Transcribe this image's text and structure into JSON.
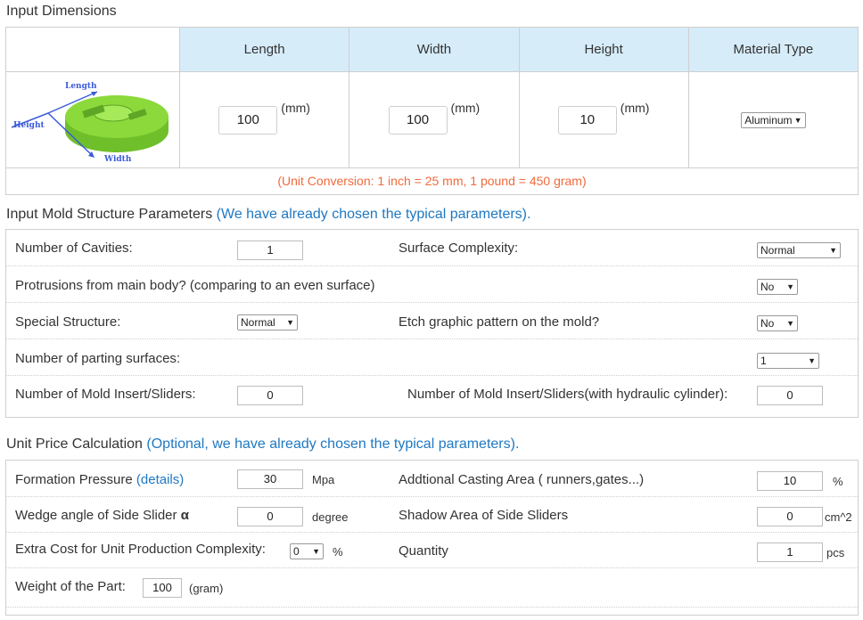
{
  "dimensions": {
    "title": "Input Dimensions",
    "headers": [
      "Length",
      "Width",
      "Height",
      "Material Type"
    ],
    "length": "100",
    "width": "100",
    "height": "10",
    "unit": "(mm)",
    "material": "Aluminum",
    "image_labels": {
      "length": "Length",
      "height": "Height",
      "width": "Width"
    },
    "unit_conversion": "(Unit Conversion: 1 inch = 25 mm, 1 pound = 450 gram)"
  },
  "mold": {
    "title": "Input Mold Structure Parameters",
    "note": "(We have already chosen the typical parameters).",
    "cavities_label": "Number of Cavities:",
    "cavities": "1",
    "surface_label": "Surface Complexity:",
    "surface": "Normal",
    "protrusions_label": "Protrusions from main body? (comparing to an even surface)",
    "protrusions": "No",
    "special_label": "Special Structure:",
    "special": "Normal",
    "etch_label": "Etch graphic pattern on the mold?",
    "etch": "No",
    "parting_label": "Number of parting surfaces:",
    "parting": "1",
    "insert_label": "Number of Mold Insert/Sliders:",
    "insert": "0",
    "insert_hyd_label": "Number of Mold Insert/Sliders(with hydraulic cylinder):",
    "insert_hyd": "0"
  },
  "unit_price": {
    "title": "Unit Price Calculation",
    "note": "(Optional, we have already chosen the typical parameters).",
    "pressure_label": "Formation Pressure",
    "pressure_link": "(details)",
    "pressure": "30",
    "pressure_unit": "Mpa",
    "casting_label": "Addtional Casting Area ( runners,gates...)",
    "casting": "10",
    "casting_unit": "%",
    "wedge_label": "Wedge angle of Side Slider",
    "wedge_symbol": "α",
    "wedge": "0",
    "wedge_unit": "degree",
    "shadow_label": "Shadow Area of Side Sliders",
    "shadow": "0",
    "shadow_unit": "cm^2",
    "extra_label": "Extra Cost for Unit Production Complexity:",
    "extra": "0",
    "extra_unit": "%",
    "quantity_label": "Quantity",
    "quantity": "1",
    "quantity_unit": "pcs",
    "weight_label": "Weight of the Part:",
    "weight": "100",
    "weight_unit": "(gram)"
  },
  "colors": {
    "header_bg": "#d6ecf9",
    "note_blue": "#1f78c1",
    "conversion_orange": "#f06a3c",
    "part_green": "#8bd93a"
  }
}
